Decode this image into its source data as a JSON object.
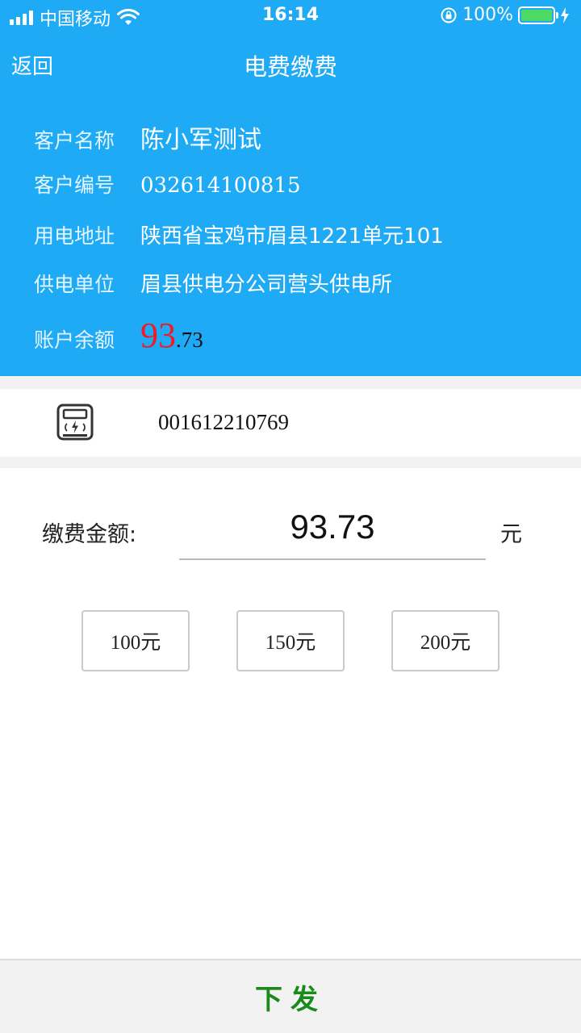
{
  "status_bar": {
    "carrier": "中国移动",
    "time": "16:14",
    "battery": "100%"
  },
  "nav": {
    "back_label": "返回",
    "title": "电费缴费"
  },
  "customer": {
    "name_label": "客户名称",
    "name": "陈小军测试",
    "id_label": "客户编号",
    "id": "032614100815",
    "address_label": "用电地址",
    "address": "陕西省宝鸡市眉县1221单元101",
    "supplier_label": "供电单位",
    "supplier": "眉县供电分公司营头供电所",
    "balance_label": "账户余额",
    "balance_int": "93",
    "balance_dec": ".73"
  },
  "meter": {
    "number": "001612210769"
  },
  "payment": {
    "amount_label": "缴费金额:",
    "amount_value": "93.73",
    "unit": "元",
    "quick_options": [
      "100元",
      "150元",
      "200元"
    ]
  },
  "footer": {
    "submit_label": "下发"
  },
  "colors": {
    "header_bg": "#1faaf5",
    "balance_red": "#ee1c25",
    "submit_green": "#1a8a1a",
    "battery_green": "#4cd964"
  }
}
